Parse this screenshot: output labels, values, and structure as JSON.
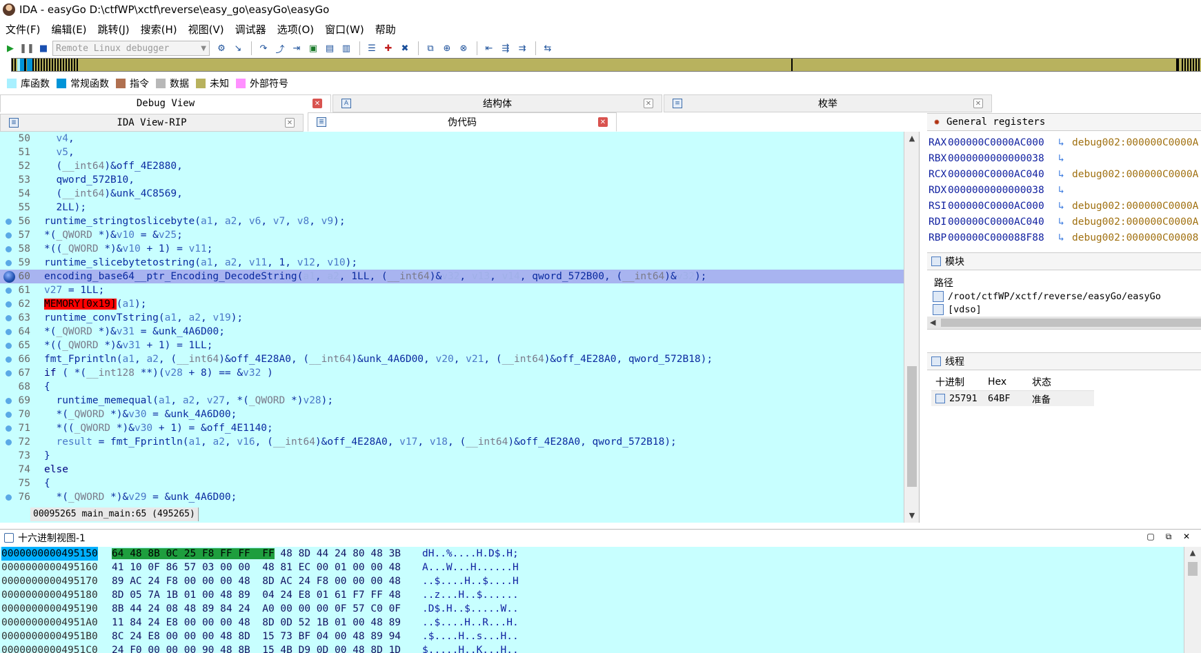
{
  "window": {
    "title": "IDA - easyGo D:\\ctfWP\\xctf\\reverse\\easy_go\\easyGo\\easyGo"
  },
  "menu": [
    "文件(F)",
    "编辑(E)",
    "跳转(J)",
    "搜索(H)",
    "视图(V)",
    "调试器",
    "选项(O)",
    "窗口(W)",
    "帮助"
  ],
  "toolbar": {
    "debugger": "Remote Linux debugger"
  },
  "legend": [
    {
      "label": "库函数",
      "color": "#a8f0ff"
    },
    {
      "label": "常规函数",
      "color": "#0094d8"
    },
    {
      "label": "指令",
      "color": "#b07050"
    },
    {
      "label": "数据",
      "color": "#b8b8b8"
    },
    {
      "label": "未知",
      "color": "#b8b25e"
    },
    {
      "label": "外部符号",
      "color": "#ff90ff"
    }
  ],
  "tabs_top": {
    "debug_view": "Debug View",
    "struct": "结构体",
    "enum": "枚举"
  },
  "tabs_second": {
    "ida_view": "IDA View-RIP",
    "pseudocode": "伪代码"
  },
  "code": {
    "status": "00095265 main_main:65 (495265)",
    "lines": [
      {
        "n": "50",
        "dot": false,
        "html": "  <span class=\"v\">v4</span>,"
      },
      {
        "n": "51",
        "dot": false,
        "html": "  <span class=\"v\">v5</span>,"
      },
      {
        "n": "52",
        "dot": false,
        "html": "  (<span class=\"g\">__int64</span>)&amp;off_4E2880,"
      },
      {
        "n": "53",
        "dot": false,
        "html": "  qword_572B10,"
      },
      {
        "n": "54",
        "dot": false,
        "html": "  (<span class=\"g\">__int64</span>)&amp;unk_4C8569,"
      },
      {
        "n": "55",
        "dot": false,
        "html": "  2LL);"
      },
      {
        "n": "56",
        "dot": true,
        "html": "runtime_stringtoslicebyte(<span class=\"v\">a1</span>, <span class=\"v\">a2</span>, <span class=\"v\">v6</span>, <span class=\"v\">v7</span>, <span class=\"v\">v8</span>, <span class=\"v\">v9</span>);"
      },
      {
        "n": "57",
        "dot": true,
        "html": "*(<span class=\"g\">_QWORD</span> *)&amp;<span class=\"v\">v10</span> = &amp;<span class=\"v\">v25</span>;"
      },
      {
        "n": "58",
        "dot": true,
        "html": "*((<span class=\"g\">_QWORD</span> *)&amp;<span class=\"v\">v10</span> + 1) = <span class=\"v\">v11</span>;"
      },
      {
        "n": "59",
        "dot": true,
        "html": "runtime_slicebytetostring(<span class=\"v\">a1</span>, <span class=\"v\">a2</span>, <span class=\"v\">v11</span>, 1, <span class=\"v\">v12</span>, <span class=\"v\">v10</span>);"
      },
      {
        "n": "60",
        "bp": true,
        "hl": true,
        "html": "encoding_base64__ptr_Encoding_DecodeString(<span class=\"vl\">a1</span>, <span class=\"vl\">a2</span>, 1LL, (<span class=\"g\">__int64</span>)&amp;<span class=\"vl\">v32</span>, <span class=\"vl\">v13</span>, <span class=\"vl\">v14</span>, qword_572B00, (<span class=\"g\">__int64</span>)&amp;<span class=\"vl\">v32</span>);"
      },
      {
        "n": "61",
        "dot": true,
        "html": "<span class=\"v\">v27</span> = 1LL;"
      },
      {
        "n": "62",
        "dot": true,
        "html": "<span class=\"mem\">MEMORY[0x19]</span>(<span class=\"v\">a1</span>);"
      },
      {
        "n": "63",
        "dot": true,
        "html": "runtime_convTstring(<span class=\"v\">a1</span>, <span class=\"v\">a2</span>, <span class=\"v\">v19</span>);"
      },
      {
        "n": "64",
        "dot": true,
        "html": "*(<span class=\"g\">_QWORD</span> *)&amp;<span class=\"v\">v31</span> = &amp;unk_4A6D00;"
      },
      {
        "n": "65",
        "dot": true,
        "html": "*((<span class=\"g\">_QWORD</span> *)&amp;<span class=\"v\">v31</span> + 1) = 1LL;"
      },
      {
        "n": "66",
        "dot": true,
        "html": "fmt_Fprintln(<span class=\"v\">a1</span>, <span class=\"v\">a2</span>, (<span class=\"g\">__int64</span>)&amp;off_4E28A0, (<span class=\"g\">__int64</span>)&amp;unk_4A6D00, <span class=\"v\">v20</span>, <span class=\"v\">v21</span>, (<span class=\"g\">__int64</span>)&amp;off_4E28A0, qword_572B18);"
      },
      {
        "n": "67",
        "dot": true,
        "html": "<span class=\"k\">if</span> ( *(<span class=\"g\">__int128</span> **)(<span class=\"v\">v28</span> + 8) == &amp;<span class=\"v\">v32</span> )"
      },
      {
        "n": "68",
        "dot": false,
        "html": "{"
      },
      {
        "n": "69",
        "dot": true,
        "html": "  runtime_memequal(<span class=\"v\">a1</span>, <span class=\"v\">a2</span>, <span class=\"v\">v27</span>, *(<span class=\"g\">_QWORD</span> *)<span class=\"v\">v28</span>);"
      },
      {
        "n": "70",
        "dot": true,
        "html": "  *(<span class=\"g\">_QWORD</span> *)&amp;<span class=\"v\">v30</span> = &amp;unk_4A6D00;"
      },
      {
        "n": "71",
        "dot": true,
        "html": "  *((<span class=\"g\">_QWORD</span> *)&amp;<span class=\"v\">v30</span> + 1) = &amp;off_4E1140;"
      },
      {
        "n": "72",
        "dot": true,
        "html": "  <span class=\"v\">result</span> = fmt_Fprintln(<span class=\"v\">a1</span>, <span class=\"v\">a2</span>, <span class=\"v\">v16</span>, (<span class=\"g\">__int64</span>)&amp;off_4E28A0, <span class=\"v\">v17</span>, <span class=\"v\">v18</span>, (<span class=\"g\">__int64</span>)&amp;off_4E28A0, qword_572B18);"
      },
      {
        "n": "73",
        "dot": false,
        "html": "}"
      },
      {
        "n": "74",
        "dot": false,
        "html": "<span class=\"k\">else</span>"
      },
      {
        "n": "75",
        "dot": false,
        "html": "{"
      },
      {
        "n": "76",
        "dot": true,
        "html": "  *(<span class=\"g\">_QWORD</span> *)&amp;<span class=\"v\">v29</span> = &amp;unk_4A6D00;"
      }
    ]
  },
  "registers": {
    "title": "General registers",
    "rows": [
      {
        "name": "RAX",
        "value": "000000C0000AC000",
        "arrow": "↳",
        "desc": "debug002:000000C0000A"
      },
      {
        "name": "RBX",
        "value": "0000000000000038",
        "arrow": "↳",
        "desc": ""
      },
      {
        "name": "RCX",
        "value": "000000C0000AC040",
        "arrow": "↳",
        "desc": "debug002:000000C0000A"
      },
      {
        "name": "RDX",
        "value": "0000000000000038",
        "arrow": "↳",
        "desc": ""
      },
      {
        "name": "RSI",
        "value": "000000C0000AC000",
        "arrow": "↳",
        "desc": "debug002:000000C0000A"
      },
      {
        "name": "RDI",
        "value": "000000C0000AC040",
        "arrow": "↳",
        "desc": "debug002:000000C0000A"
      },
      {
        "name": "RBP",
        "value": "000000C000088F88",
        "arrow": "↳",
        "desc": "debug002:000000C00008"
      }
    ]
  },
  "modules": {
    "title": "模块",
    "header": "路径",
    "rows": [
      "/root/ctfWP/xctf/reverse/easyGo/easyGo",
      "[vdso]"
    ]
  },
  "threads": {
    "title": "线程",
    "columns": [
      "十进制",
      "Hex",
      "状态"
    ],
    "rows": [
      {
        "dec": "25791",
        "hex": "64BF",
        "state": "准备"
      }
    ]
  },
  "hex": {
    "title": "十六进制视图-1",
    "rows": [
      {
        "addr": "0000000000495150",
        "sel": "64 48 8B 0C 25 F8 FF FF  FF",
        "bytes": " 48 8D 44 24 80 48 3B",
        "ascii": "dH..%....H.D$.H;"
      },
      {
        "addr": "0000000000495160",
        "sel": "",
        "bytes": "41 10 0F 86 57 03 00 00  48 81 EC 00 01 00 00 48",
        "ascii": "A...W...H......H"
      },
      {
        "addr": "0000000000495170",
        "sel": "",
        "bytes": "89 AC 24 F8 00 00 00 48  8D AC 24 F8 00 00 00 48",
        "ascii": "..$....H..$....H"
      },
      {
        "addr": "0000000000495180",
        "sel": "",
        "bytes": "8D 05 7A 1B 01 00 48 89  04 24 E8 01 61 F7 FF 48",
        "ascii": "..z...H..$......"
      },
      {
        "addr": "0000000000495190",
        "sel": "",
        "bytes": "8B 44 24 08 48 89 84 24  A0 00 00 00 0F 57 C0 0F",
        "ascii": ".D$.H..$.....W.."
      },
      {
        "addr": "00000000004951A0",
        "sel": "",
        "bytes": "11 84 24 E8 00 00 00 48  8D 0D 52 1B 01 00 48 89",
        "ascii": "..$....H..R...H."
      },
      {
        "addr": "00000000004951B0",
        "sel": "",
        "bytes": "8C 24 E8 00 00 00 48 8D  15 73 BF 04 00 48 89 94",
        "ascii": ".$....H..s...H.."
      },
      {
        "addr": "00000000004951C0",
        "sel": "",
        "bytes": "24 F0 00 00 00 90 48 8B  15 4B D9 0D 00 48 8D 1D",
        "ascii": "$.....H..K...H.."
      }
    ]
  }
}
